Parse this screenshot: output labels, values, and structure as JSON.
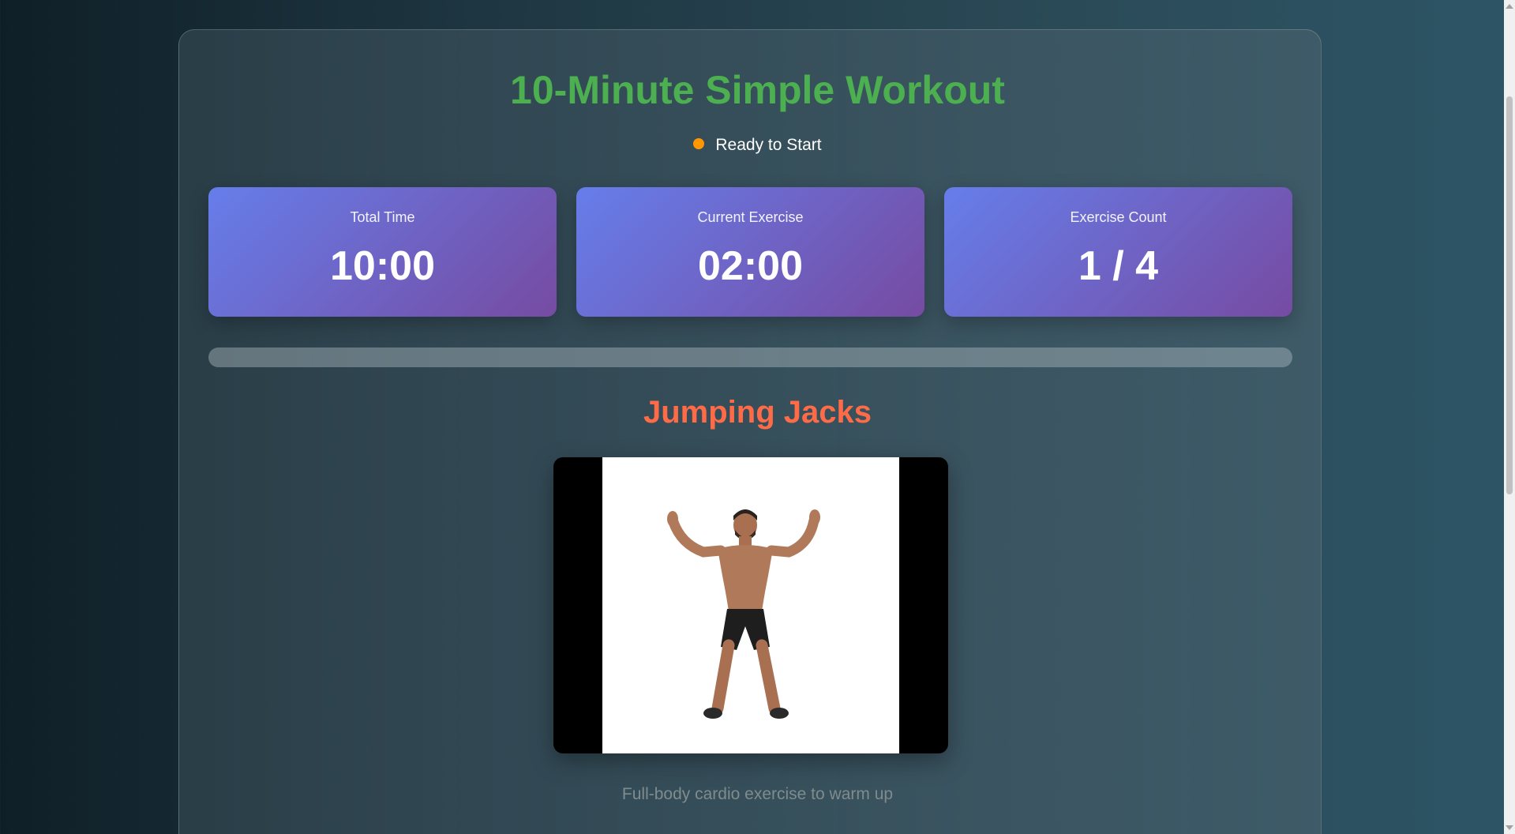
{
  "header": {
    "title": "10-Minute Simple Workout",
    "status_text": "Ready to Start"
  },
  "stats": [
    {
      "label": "Total Time",
      "value": "10:00"
    },
    {
      "label": "Current Exercise",
      "value": "02:00"
    },
    {
      "label": "Exercise Count",
      "value": "1 / 4"
    }
  ],
  "progress": {
    "fraction": 0
  },
  "exercise": {
    "name": "Jumping Jacks",
    "description": "Full-body cardio exercise to warm up",
    "image_icon": "jumping-jacks-person"
  },
  "colors": {
    "title": "#4caf50",
    "status_dot": "#ff9800",
    "exercise_name": "#ff6b47",
    "stat_gradient_start": "#667eea",
    "stat_gradient_end": "#764ba2"
  }
}
